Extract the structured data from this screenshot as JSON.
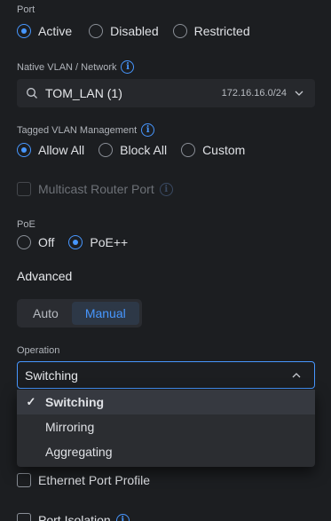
{
  "port": {
    "label": "Port",
    "options": [
      {
        "label": "Active",
        "selected": true
      },
      {
        "label": "Disabled",
        "selected": false
      },
      {
        "label": "Restricted",
        "selected": false
      }
    ]
  },
  "native_vlan": {
    "label": "Native VLAN / Network",
    "value": "TOM_LAN (1)",
    "subnet": "172.16.16.0/24"
  },
  "tagged_vlan": {
    "label": "Tagged VLAN Management",
    "options": [
      {
        "label": "Allow All",
        "selected": true
      },
      {
        "label": "Block All",
        "selected": false
      },
      {
        "label": "Custom",
        "selected": false
      }
    ]
  },
  "multicast": {
    "label": "Multicast Router Port",
    "checked": false,
    "disabled": true
  },
  "poe": {
    "label": "PoE",
    "options": [
      {
        "label": "Off",
        "selected": false
      },
      {
        "label": "PoE++",
        "selected": true
      }
    ]
  },
  "advanced": {
    "title": "Advanced",
    "modes": [
      {
        "label": "Auto",
        "selected": false
      },
      {
        "label": "Manual",
        "selected": true
      }
    ]
  },
  "operation": {
    "label": "Operation",
    "value": "Switching",
    "options": [
      {
        "label": "Switching",
        "selected": true
      },
      {
        "label": "Mirroring",
        "selected": false
      },
      {
        "label": "Aggregating",
        "selected": false
      }
    ]
  },
  "ethernet_port_profile": {
    "label": "Ethernet Port Profile",
    "checked": false
  },
  "port_isolation": {
    "label": "Port Isolation"
  },
  "colors": {
    "accent": "#4797ff",
    "background": "#1c1e21"
  }
}
